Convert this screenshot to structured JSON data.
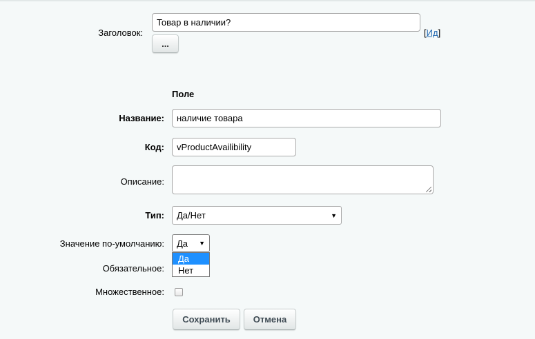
{
  "header": {
    "label": "Заголовок:",
    "value": "Товар в наличии?",
    "more_button": "...",
    "lang_prefix": "[",
    "lang_link": "Ид",
    "lang_suffix": "]"
  },
  "field": {
    "section_title": "Поле",
    "name_label": "Название:",
    "name_value": "наличие товара",
    "code_label": "Код:",
    "code_value": "vProductAvailibility",
    "description_label": "Описание:",
    "description_value": "",
    "type_label": "Тип:",
    "type_value": "Да/Нет",
    "default_label": "Значение по-умолчанию:",
    "default_value": "Да",
    "default_options": [
      "Да",
      "Нет"
    ],
    "required_label": "Обязательное:",
    "multiple_label": "Множественное:"
  },
  "actions": {
    "save": "Сохранить",
    "cancel": "Отмена"
  }
}
